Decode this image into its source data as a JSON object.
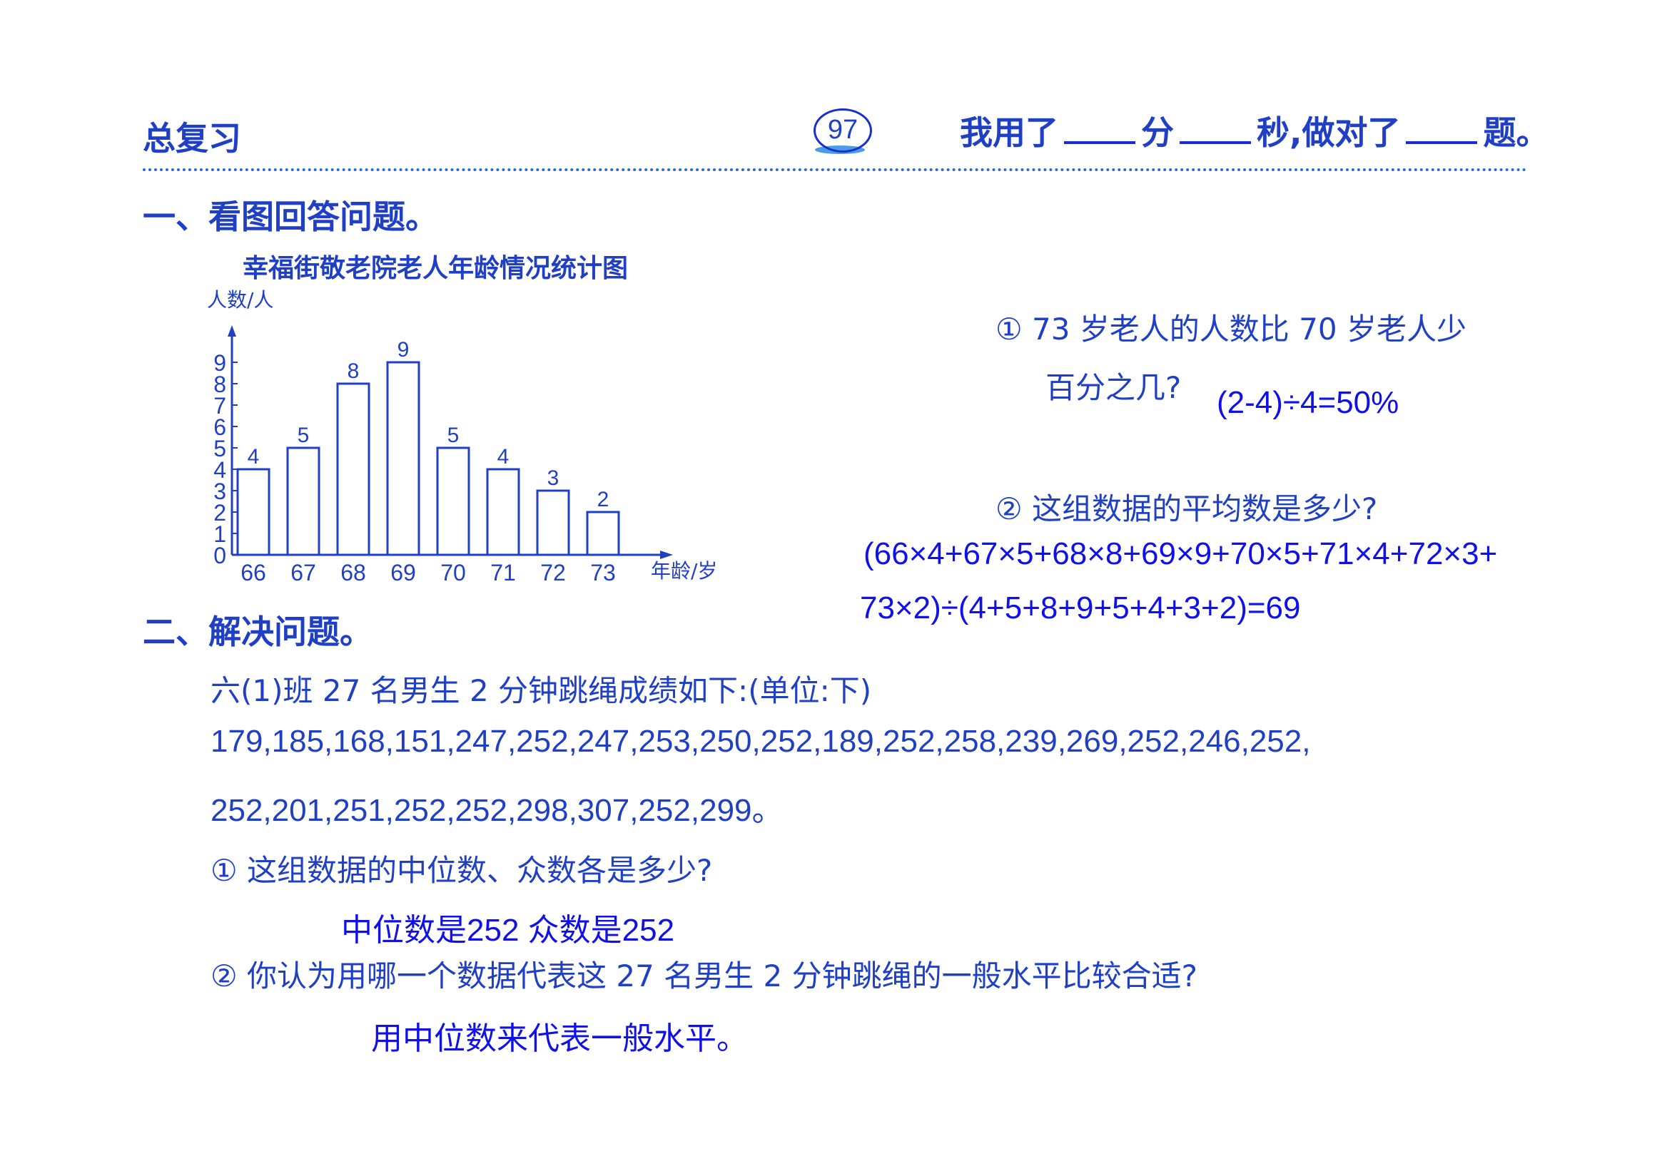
{
  "header": {
    "title": "总复习",
    "page_number": "97",
    "timer_prefix": "我用了",
    "timer_minutes_unit": "分",
    "timer_seconds_unit": "秒,做对了",
    "timer_questions_unit": "题。"
  },
  "section1": {
    "heading": "一、看图回答问题。",
    "q1_line1": "① 73 岁老人的人数比 70 岁老人少",
    "q1_line2": "百分之几?",
    "q1_answer": "(2-4)÷4=50%",
    "q2": "② 这组数据的平均数是多少?",
    "q2_answer_line1": "(66×4+67×5+68×8+69×9+70×5+71×4+72×3+",
    "q2_answer_line2": "73×2)÷(4+5+8+9+5+4+3+2)=69"
  },
  "chart_data": {
    "type": "bar",
    "title": "幸福街敬老院老人年龄情况统计图",
    "xlabel": "年龄/岁",
    "ylabel": "人数/人",
    "categories": [
      "66",
      "67",
      "68",
      "69",
      "70",
      "71",
      "72",
      "73"
    ],
    "values": [
      4,
      5,
      8,
      9,
      5,
      4,
      3,
      2
    ],
    "yticks": [
      "0",
      "1",
      "2",
      "3",
      "4",
      "5",
      "6",
      "7",
      "8",
      "9"
    ],
    "ylim": [
      0,
      9
    ],
    "grid": false,
    "data_labels": true
  },
  "section2": {
    "heading": "二、解决问题。",
    "intro": "六(1)班 27 名男生 2 分钟跳绳成绩如下:(单位:下)",
    "data_line1": "179,185,168,151,247,252,247,253,250,252,189,252,258,239,269,252,246,252,",
    "data_line2": "252,201,251,252,252,298,307,252,299。",
    "q1": "① 这组数据的中位数、众数各是多少?",
    "q1_answer": "中位数是252  众数是252",
    "q2": "② 你认为用哪一个数据代表这 27 名男生 2 分钟跳绳的一般水平比较合适?",
    "q2_answer": "用中位数来代表一般水平。"
  },
  "colors": {
    "print_blue": "#1f3fc4",
    "handwritten_blue": "#1010e8",
    "divider": "#2a6fd0"
  }
}
